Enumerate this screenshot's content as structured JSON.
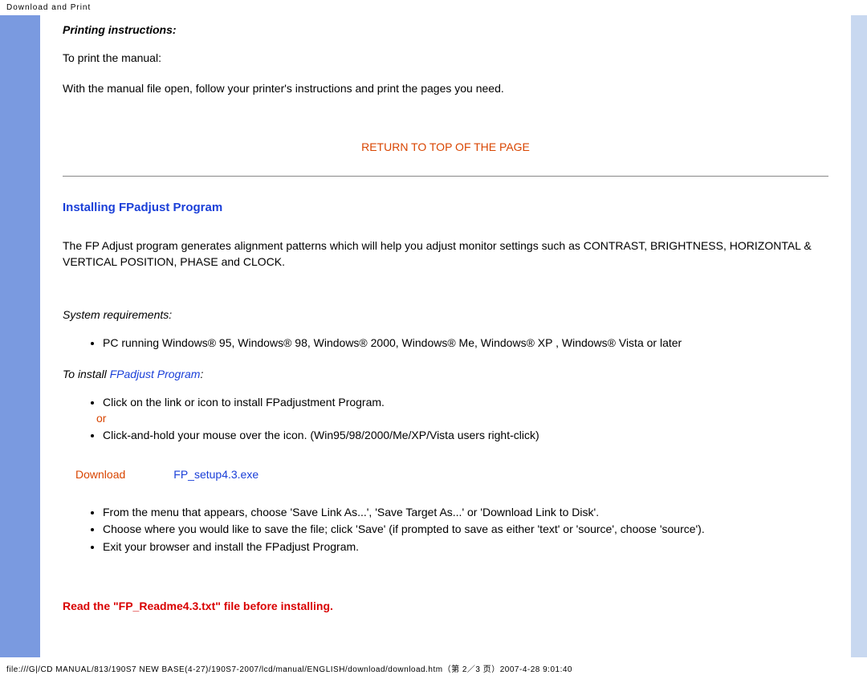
{
  "header": "Download and Print",
  "printing": {
    "title": "Printing instructions:",
    "p1": "To print the manual:",
    "p2": "With the manual file open, follow your printer's instructions and print the pages you need."
  },
  "top_link": "RETURN TO TOP OF THE PAGE",
  "installing": {
    "heading": "Installing FPadjust Program",
    "desc": "The FP Adjust program generates alignment patterns which will help you adjust monitor settings such as CONTRAST, BRIGHTNESS, HORIZONTAL & VERTICAL POSITION, PHASE and CLOCK.",
    "sysreq_title": "System requirements:",
    "sysreq_item": "PC running Windows® 95, Windows® 98, Windows® 2000, Windows® Me, Windows® XP , Windows® Vista or later",
    "install_title_pre": "To install ",
    "install_title_link": "FPadjust Program",
    "install_title_post": ":",
    "step1": "Click on the link or icon to install FPadjustment Program.",
    "or": "or",
    "step2": "Click-and-hold your mouse over the icon. (Win95/98/2000/Me/XP/Vista users right-click)",
    "download_label": "Download",
    "download_link": "FP_setup4.3.exe",
    "menu1": "From the menu that appears, choose 'Save Link As...', 'Save Target As...' or 'Download Link to Disk'.",
    "menu2": "Choose where you would like to save the file; click 'Save' (if prompted to save as either 'text' or 'source', choose 'source').",
    "menu3": "Exit your browser and install the FPadjust Program.",
    "warning": "Read the \"FP_Readme4.3.txt\" file before installing."
  },
  "footer": "file:///G|/CD MANUAL/813/190S7 NEW BASE(4-27)/190S7-2007/lcd/manual/ENGLISH/download/download.htm（第 2／3 页）2007-4-28 9:01:40"
}
